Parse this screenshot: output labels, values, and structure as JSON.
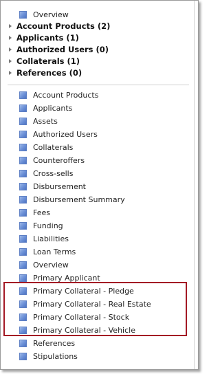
{
  "top": {
    "overview_label": "Overview"
  },
  "groups": [
    {
      "label": "Account Products (2)"
    },
    {
      "label": "Applicants (1)"
    },
    {
      "label": "Authorized Users (0)"
    },
    {
      "label": "Collaterals (1)"
    },
    {
      "label": "References (0)"
    }
  ],
  "items": [
    {
      "label": "Account Products"
    },
    {
      "label": "Applicants"
    },
    {
      "label": "Assets"
    },
    {
      "label": "Authorized Users"
    },
    {
      "label": "Collaterals"
    },
    {
      "label": "Counteroffers"
    },
    {
      "label": "Cross-sells"
    },
    {
      "label": "Disbursement"
    },
    {
      "label": "Disbursement Summary"
    },
    {
      "label": "Fees"
    },
    {
      "label": "Funding"
    },
    {
      "label": "Liabilities"
    },
    {
      "label": "Loan Terms"
    },
    {
      "label": "Overview"
    },
    {
      "label": "Primary Applicant"
    },
    {
      "label": "Primary Collateral - Pledge"
    },
    {
      "label": "Primary Collateral - Real Estate"
    },
    {
      "label": "Primary Collateral - Stock"
    },
    {
      "label": "Primary Collateral - Vehicle"
    },
    {
      "label": "References"
    },
    {
      "label": "Stipulations"
    }
  ],
  "colors": {
    "highlight_border": "#a31824",
    "icon_fill": "#6a8fd6"
  }
}
